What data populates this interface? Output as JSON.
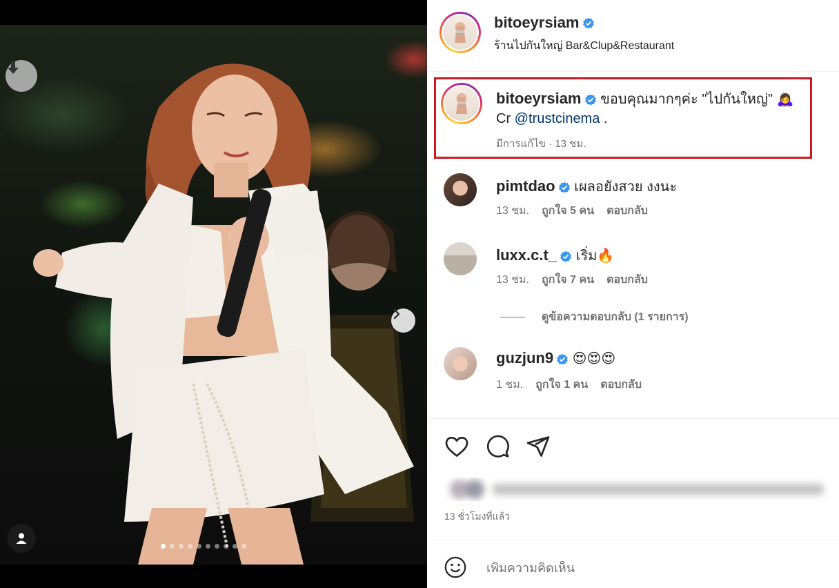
{
  "post": {
    "username": "bitoeyrsiam",
    "location": "ร้านไปกันใหญ่ Bar&Clup&Restaurant"
  },
  "media": {
    "slide_count": 10,
    "active_slide": 1
  },
  "caption": {
    "username": "bitoeyrsiam",
    "text": "ขอบคุณมากๆค่ะ \"ไปกันใหญ่\" 🙇‍♀️",
    "credit_prefix": "Cr",
    "credit_mention": "@trustcinema",
    "credit_suffix": ".",
    "meta": "มีการแก้ไข · 13 ชม."
  },
  "comments": [
    {
      "username": "pimtdao",
      "text": "เผลอยังสวย งงนะ",
      "time": "13 ชม.",
      "likes": "ถูกใจ 5 คน",
      "reply": "ตอบกลับ"
    },
    {
      "username": "luxx.c.t_",
      "text": "เริ่ม🔥",
      "time": "13 ชม.",
      "likes": "ถูกใจ 7 คน",
      "reply": "ตอบกลับ"
    },
    {
      "username": "guzjun9",
      "text": "😍😍😍",
      "time": "1 ชม.",
      "likes": "ถูกใจ 1 คน",
      "reply": "ตอบกลับ"
    }
  ],
  "view_replies": "ดูข้อความตอบกลับ (1 รายการ)",
  "time_ago": "13 ชั่วโมงที่แล้ว",
  "add_comment": {
    "placeholder": "เพิ่มความคิดเห็น"
  },
  "icons": {
    "verified": "verified-badge-icon",
    "like": "heart-icon",
    "comment": "comment-bubble-icon",
    "share": "paper-plane-icon",
    "emoji": "smiley-icon",
    "download": "download-arrow-icon",
    "next": "chevron-right-icon",
    "user": "user-tag-icon"
  },
  "colors": {
    "verified": "#3897f0",
    "mention": "#00376b",
    "highlight_box": "#d0161e",
    "muted": "#737373"
  }
}
